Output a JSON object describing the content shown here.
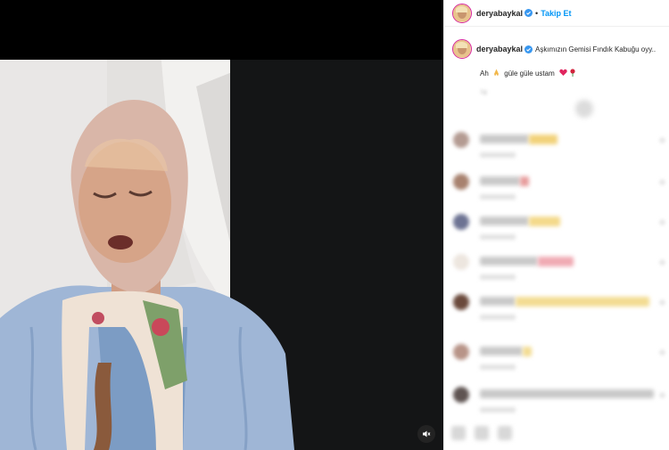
{
  "post": {
    "username": "deryabaykal",
    "follow_label": "Takip Et",
    "separator": "•",
    "verified_icon": "verified-badge-icon",
    "accent_color": "#0095f6"
  },
  "caption": {
    "text": "Aşkımızın Gemisi Fındık Kabuğu oyy..",
    "line2_prefix": "Ah",
    "line2_text": "güle güle ustam",
    "emojis": [
      "folded-hands-icon",
      "red-heart-icon",
      "red-rose-icon"
    ],
    "time_blurred": "1g"
  },
  "media": {
    "mute_icon": "speaker-muted-icon"
  },
  "comments": [
    {
      "avatar_color": "#b49b92",
      "line_width": 55,
      "emoji_color": "#f2d27a",
      "emoji_width": 32
    },
    {
      "avatar_color": "#a8826f",
      "line_width": 45,
      "emoji_color": "#e79c9c",
      "emoji_width": 10
    },
    {
      "avatar_color": "#6d7393",
      "line_width": 55,
      "emoji_color": "#f4d98a",
      "emoji_width": 35
    },
    {
      "avatar_color": "#ede6df",
      "line_width": 65,
      "emoji_color": "#f0aab3",
      "emoji_width": 40
    },
    {
      "avatar_color": "#6b4a3c",
      "line_width": 40,
      "emoji_color": "#f3dc92",
      "emoji_width": 150
    },
    {
      "avatar_color": "#b89488",
      "line_width": 48,
      "emoji_color": "#f3dc92",
      "emoji_width": 10
    },
    {
      "avatar_color": "#5f5452",
      "line_width": 195,
      "emoji_color": "#d0d0d0",
      "emoji_width": 0
    }
  ]
}
